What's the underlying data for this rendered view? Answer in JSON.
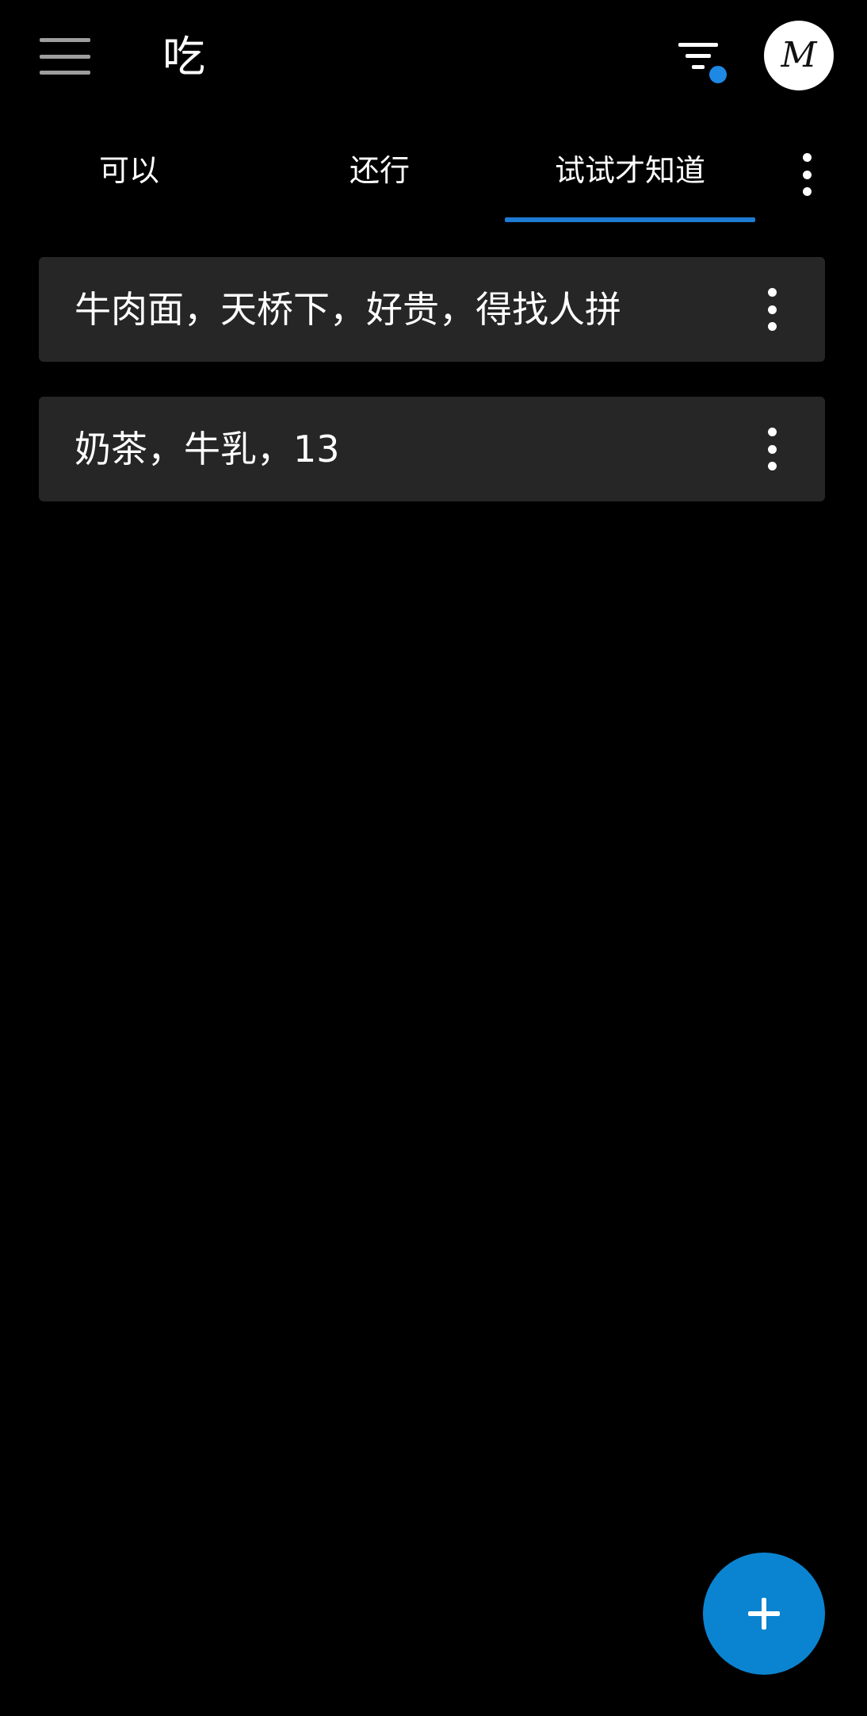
{
  "app_bar": {
    "menu_icon": "hamburger-menu-icon",
    "title": "吃",
    "filter_icon": "filter-icon",
    "filter_badge_color": "#1e88e5",
    "avatar_letter": "M"
  },
  "tabs": {
    "items": [
      {
        "label": "可以"
      },
      {
        "label": "还行"
      },
      {
        "label": "试试才知道"
      }
    ],
    "selected": "试试才知道",
    "indicator_color": "#1e7bd2",
    "more_icon": "more-vertical-icon"
  },
  "list": {
    "items": [
      {
        "text": "牛肉面，天桥下，好贵，得找人拼",
        "menu_icon": "more-vertical-icon"
      },
      {
        "text": "奶茶，牛乳，13",
        "menu_icon": "more-vertical-icon"
      }
    ]
  },
  "fab": {
    "icon": "plus-icon",
    "color": "#0a84d0"
  },
  "colors": {
    "background": "#000000",
    "card": "#262626",
    "accent": "#1e7bd2"
  }
}
